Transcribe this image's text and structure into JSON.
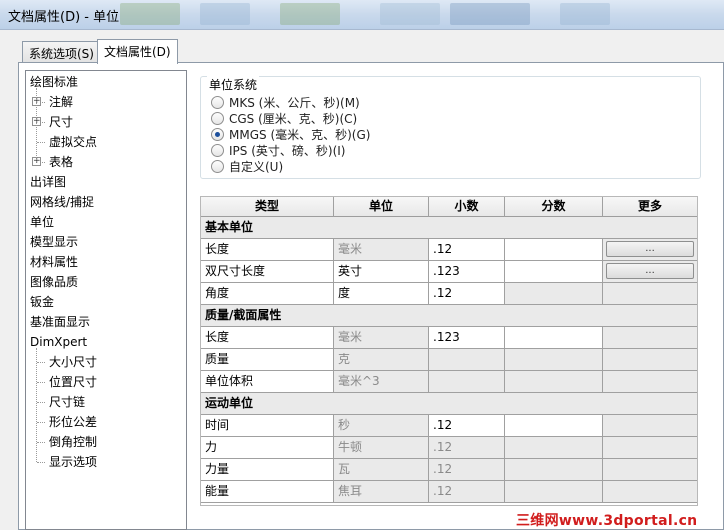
{
  "window": {
    "title": "文档属性(D) - 单位"
  },
  "tabs": [
    {
      "label": "系统选项(S)",
      "active": false
    },
    {
      "label": "文档属性(D)",
      "active": true
    }
  ],
  "tree": {
    "items": [
      {
        "label": "绘图标准",
        "level": 0,
        "expander": false
      },
      {
        "label": "注解",
        "level": 1,
        "expander": true
      },
      {
        "label": "尺寸",
        "level": 1,
        "expander": true
      },
      {
        "label": "虚拟交点",
        "level": 1,
        "expander": false
      },
      {
        "label": "表格",
        "level": 1,
        "expander": true
      },
      {
        "label": "出详图",
        "level": 0,
        "expander": false
      },
      {
        "label": "网格线/捕捉",
        "level": 0,
        "expander": false
      },
      {
        "label": "单位",
        "level": 0,
        "expander": false,
        "selected": true
      },
      {
        "label": "模型显示",
        "level": 0,
        "expander": false
      },
      {
        "label": "材料属性",
        "level": 0,
        "expander": false
      },
      {
        "label": "图像品质",
        "level": 0,
        "expander": false
      },
      {
        "label": "钣金",
        "level": 0,
        "expander": false
      },
      {
        "label": "基准面显示",
        "level": 0,
        "expander": false
      },
      {
        "label": "DimXpert",
        "level": 0,
        "expander": false
      },
      {
        "label": "大小尺寸",
        "level": 1,
        "expander": false
      },
      {
        "label": "位置尺寸",
        "level": 1,
        "expander": false
      },
      {
        "label": "尺寸链",
        "level": 1,
        "expander": false
      },
      {
        "label": "形位公差",
        "level": 1,
        "expander": false
      },
      {
        "label": "倒角控制",
        "level": 1,
        "expander": false
      },
      {
        "label": "显示选项",
        "level": 1,
        "expander": false
      }
    ]
  },
  "unit_system": {
    "legend": "单位系统",
    "options": [
      {
        "label": "MKS (米、公斤、秒)(M)",
        "selected": false
      },
      {
        "label": "CGS (厘米、克、秒)(C)",
        "selected": false
      },
      {
        "label": "MMGS (毫米、克、秒)(G)",
        "selected": true
      },
      {
        "label": "IPS (英寸、磅、秒)(I)",
        "selected": false
      },
      {
        "label": "自定义(U)",
        "selected": false
      }
    ]
  },
  "units_table": {
    "columns": [
      "类型",
      "单位",
      "小数",
      "分数",
      "更多"
    ],
    "more_button_label": "...",
    "sections": [
      {
        "title": "基本单位",
        "rows": [
          {
            "type": "长度",
            "unit": "毫米",
            "unit_dim": true,
            "decimals": ".12",
            "decimals_dim": false,
            "fraction": "",
            "more": true
          },
          {
            "type": "双尺寸长度",
            "unit": "英寸",
            "unit_dim": false,
            "decimals": ".123",
            "decimals_dim": false,
            "fraction": "",
            "more": true
          },
          {
            "type": "角度",
            "unit": "度",
            "unit_dim": false,
            "decimals": ".12",
            "decimals_dim": false,
            "fraction": "",
            "more": false
          }
        ]
      },
      {
        "title": "质量/截面属性",
        "rows": [
          {
            "type": "长度",
            "unit": "毫米",
            "unit_dim": true,
            "decimals": ".123",
            "decimals_dim": false,
            "fraction": "",
            "more": false
          },
          {
            "type": "质量",
            "unit": "克",
            "unit_dim": true,
            "decimals": "",
            "decimals_dim": false,
            "fraction": "",
            "more": false
          },
          {
            "type": "单位体积",
            "unit": "毫米^3",
            "unit_dim": true,
            "decimals": "",
            "decimals_dim": false,
            "fraction": "",
            "more": false
          }
        ]
      },
      {
        "title": "运动单位",
        "rows": [
          {
            "type": "时间",
            "unit": "秒",
            "unit_dim": true,
            "decimals": ".12",
            "decimals_dim": false,
            "fraction": "",
            "more": false
          },
          {
            "type": "力",
            "unit": "牛顿",
            "unit_dim": true,
            "decimals": ".12",
            "decimals_dim": true,
            "fraction": "",
            "more": false
          },
          {
            "type": "力量",
            "unit": "瓦",
            "unit_dim": true,
            "decimals": ".12",
            "decimals_dim": true,
            "fraction": "",
            "more": false
          },
          {
            "type": "能量",
            "unit": "焦耳",
            "unit_dim": true,
            "decimals": ".12",
            "decimals_dim": true,
            "fraction": "",
            "more": false
          }
        ]
      }
    ]
  },
  "watermark": {
    "text": "三维网www.3dportal.cn",
    "color": "#d11d1d"
  }
}
